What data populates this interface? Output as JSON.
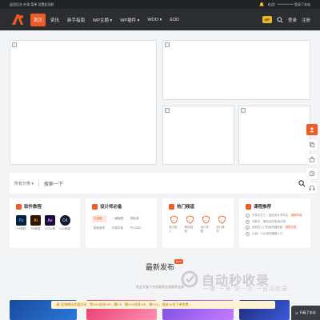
{
  "topbar": {
    "left_text": "返回后台 外观 菜单 设置此导航",
    "user_text": "欢迎！************* 登录了本站"
  },
  "nav": {
    "items": [
      {
        "label": "首页",
        "active": true
      },
      {
        "label": "资讯",
        "active": false
      },
      {
        "label": "新手指南",
        "active": false
      },
      {
        "label": "WP主题 ▾",
        "active": false
      },
      {
        "label": "WP插件 ▾",
        "active": false
      },
      {
        "label": "WOO ▾",
        "active": false
      },
      {
        "label": "EDD",
        "active": false
      }
    ],
    "vip_label": "VIP",
    "login_label": "登录",
    "register_label": "注册",
    "accent_color": "#f15a24"
  },
  "search": {
    "category_label": "所有分类 ▾",
    "placeholder": "搜索一下"
  },
  "software": {
    "title": "软件教程",
    "apps": [
      {
        "abbr": "Ps",
        "label": "PS教程",
        "bg": "#0b1e3b",
        "fg": "#31a8ff"
      },
      {
        "abbr": "Ai",
        "label": "PR教程",
        "bg": "#2e1500",
        "fg": "#ff9a00"
      },
      {
        "abbr": "Ae",
        "label": "HTML教",
        "bg": "#1c0a3b",
        "fg": "#d291ff"
      },
      {
        "abbr": "C4",
        "label": "C4D教程",
        "bg": "#0f1a2e",
        "fg": "#9fb7e0"
      }
    ]
  },
  "design": {
    "title": "设计师必备",
    "chips": [
      {
        "label": "平面图",
        "highlight": true
      },
      {
        "label": "一键抠图",
        "highlight": false
      },
      {
        "label": "搜标准",
        "highlight": false
      },
      {
        "label": "配色参考",
        "highlight": false
      },
      {
        "label": "在线字体",
        "highlight": false
      },
      {
        "label": "PS 2020",
        "highlight": false
      }
    ]
  },
  "hot": {
    "title": "热门频道",
    "items": [
      {
        "label": "吸引投入"
      },
      {
        "label": "精站视频"
      },
      {
        "label": "设计专题"
      },
      {
        "label": "设计素材"
      }
    ]
  },
  "recommend": {
    "title": "课程推荐",
    "items": [
      {
        "text": "忘年长打工，图形设计学字生",
        "tag": "钢筋同感"
      },
      {
        "text": "问新手，哪些站内常用分类",
        "tag": ""
      },
      {
        "text": "如何在入门阶段构建系统",
        "tag": "钢筋无限"
      },
      {
        "text": "以前！C4D如何建模入门",
        "tag": ""
      }
    ]
  },
  "latest": {
    "title": "最新发布",
    "badge": "NEW",
    "subtitle": "找全文复个作而推荐全部推荐全部"
  },
  "banner": {
    "text": "🔥 促销期间优惠活动：赞XXX加年VIP，赠XX，赠XXX终身VIP，赠XXX，限前XX名下单免费..."
  },
  "watermark": {
    "text": "自动秒收录",
    "subtitle": "一键·一来·访一次·一自动收录"
  },
  "corner_button": {
    "label": "升级了本站"
  },
  "sidebar_icons": [
    {
      "name": "user-icon",
      "orange": true
    },
    {
      "name": "copy-icon",
      "orange": false
    },
    {
      "name": "basket-icon",
      "orange": false
    },
    {
      "name": "clock-icon",
      "orange": false
    },
    {
      "name": "headset-icon",
      "orange": false
    },
    {
      "name": "arrow-up-icon",
      "orange": false
    }
  ]
}
